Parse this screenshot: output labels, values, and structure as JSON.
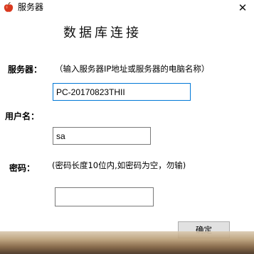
{
  "window": {
    "title": "服务器",
    "close_glyph": "✕"
  },
  "heading": "数据库连接",
  "server": {
    "label": "服务器：",
    "hint": "（输入服务器IP地址或服务器的电脑名称）",
    "value": "PC-20170823THII"
  },
  "user": {
    "label": "用户名：",
    "value": "sa"
  },
  "password": {
    "label": "密码：",
    "hint": "(密码长度10位内,如密码为空，勿输)",
    "value": ""
  },
  "confirm_button": "确定",
  "icons": {
    "app_icon": "apple-icon",
    "close_icon": "close-icon"
  },
  "colors": {
    "focus_border": "#0078d7",
    "button_bg": "#e1e1e1",
    "app_icon_red": "#d9381e"
  }
}
